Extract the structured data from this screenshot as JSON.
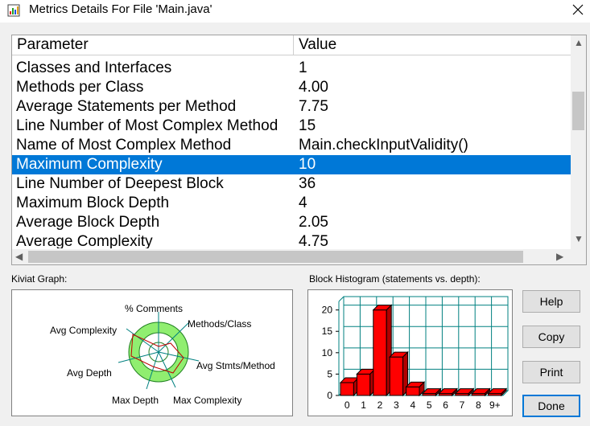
{
  "window": {
    "title": "Metrics Details For File 'Main.java'"
  },
  "table": {
    "headers": [
      "Parameter",
      "Value"
    ],
    "rows": [
      {
        "param": "Classes and Interfaces",
        "value": "1"
      },
      {
        "param": "Methods per Class",
        "value": "4.00"
      },
      {
        "param": "Average Statements per Method",
        "value": "7.75"
      },
      {
        "param": "Line Number of Most Complex Method",
        "value": "15"
      },
      {
        "param": "Name of Most Complex Method",
        "value": "Main.checkInputValidity()"
      },
      {
        "param": "Maximum Complexity",
        "value": "10",
        "selected": true
      },
      {
        "param": "Line Number of Deepest Block",
        "value": "36"
      },
      {
        "param": "Maximum Block Depth",
        "value": "4"
      },
      {
        "param": "Average Block Depth",
        "value": "2.05"
      },
      {
        "param": "Average Complexity",
        "value": "4.75"
      }
    ]
  },
  "kiviat": {
    "label": "Kiviat Graph:",
    "axes": [
      "% Comments",
      "Methods/Class",
      "Avg Stmts/Method",
      "Max Complexity",
      "Max Depth",
      "Avg Depth",
      "Avg Complexity"
    ]
  },
  "histogram": {
    "label": "Block Histogram (statements vs. depth):"
  },
  "chart_data": {
    "type": "bar",
    "categories": [
      "0",
      "1",
      "2",
      "3",
      "4",
      "5",
      "6",
      "7",
      "8",
      "9+"
    ],
    "values": [
      3,
      5,
      20,
      9,
      2,
      0,
      0,
      0,
      0,
      0
    ],
    "yticks": [
      0,
      5,
      10,
      15,
      20
    ],
    "ylim": [
      0,
      22
    ],
    "bar_color": "#ff0000",
    "grid": true
  },
  "buttons": {
    "help": "Help",
    "copy": "Copy",
    "print": "Print",
    "done": "Done"
  },
  "colors": {
    "selection": "#0078d7",
    "kiviat_fill": "#90ee70"
  }
}
